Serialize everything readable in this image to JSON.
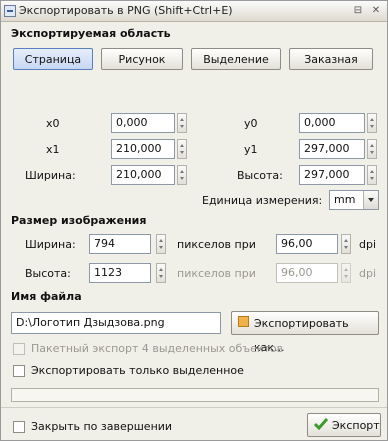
{
  "window": {
    "title": "Экспортировать в PNG (Shift+Ctrl+E)",
    "title_btn_1": "⊟",
    "title_btn_2": "✕"
  },
  "export_area": {
    "heading": "Экспортируемая область",
    "tabs": [
      {
        "label": "Страница",
        "active": true
      },
      {
        "label": "Рисунок",
        "active": false
      },
      {
        "label": "Выделение",
        "active": false
      },
      {
        "label": "Заказная",
        "active": false
      }
    ],
    "x0_label": "x0",
    "x0_value": "0,000",
    "y0_label": "y0",
    "y0_value": "0,000",
    "x1_label": "x1",
    "x1_value": "210,000",
    "y1_label": "y1",
    "y1_value": "297,000",
    "width_label": "Ширина:",
    "width_value": "210,000",
    "height_label": "Высота:",
    "height_value": "297,000",
    "units_label": "Единица измерения:",
    "units_value": "mm"
  },
  "image_size": {
    "heading": "Размер изображения",
    "width_label": "Ширина:",
    "width_value": "794",
    "pixels_at_1": "пикселов при",
    "dpi_value_1": "96,00",
    "dpi_unit_1": "dpi",
    "height_label": "Высота:",
    "height_value": "1123",
    "pixels_at_2": "пикселов при",
    "dpi_value_2": "96,00",
    "dpi_unit_2": "dpi"
  },
  "filename": {
    "heading": "Имя файла",
    "value": "D:\\Логотип Дзыдзова.png",
    "export_as_button": "Экспортировать как..."
  },
  "options": {
    "batch_export": "Пакетный экспорт 4 выделенных объектов",
    "hide_unselected": "Экспортировать только выделенное",
    "close_when_done": "Закрыть по завершении"
  },
  "footer": {
    "export_button": "Экспорт"
  },
  "colors": {
    "accent": "#5a7fbf",
    "check_green": "#3f9a2e"
  }
}
